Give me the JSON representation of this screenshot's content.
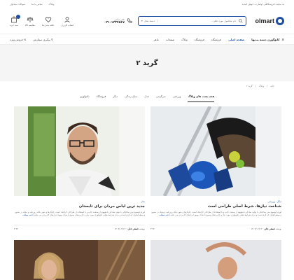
{
  "topbar": {
    "promo": "به سایت فروشگاهی اولمارت خوش آمدید",
    "links": [
      "وبلاگ",
      "تماس با ما",
      "سوالات متداول"
    ]
  },
  "header": {
    "logo": "olmart",
    "search_placeholder": "نام محصول مورد نظر...",
    "search_category": "دسته بندی",
    "phone_label": "تلفن تماس",
    "phone_number": "۰۲۱-۱۲۳۴۵۶۷",
    "icons": [
      {
        "name": "cart",
        "label": "سبد خرید",
        "badge": "۰"
      },
      {
        "name": "compare",
        "label": "مقایسه کالا"
      },
      {
        "name": "wishlist",
        "label": "علاقه مندی ها"
      },
      {
        "name": "account",
        "label": "حساب کاربری"
      }
    ]
  },
  "nav": {
    "categories_label": "کاتوگوری دسته بندیها",
    "items": [
      "صفحه اصلی",
      "فروشگاه",
      "فروشگاه",
      "وبلاگ",
      "صفحات",
      "ماهر"
    ],
    "left": [
      "پیگیری سفارش",
      "فروش ویژه"
    ]
  },
  "page": {
    "title": "گرید ۲",
    "breadcrumb": [
      "خانه",
      "وبلاگ",
      "گرید ۲"
    ]
  },
  "filters": [
    "همه پست های وبلاگ",
    "ورزشی",
    "سرگرمی",
    "مدل",
    "سبک زندگی",
    "دیگر",
    "فروشگاه",
    "تکنولوژی"
  ],
  "posts": [
    {
      "category": "دیگر ، ورزشی",
      "title": "شناخت نیازها، شرط اصلی طراحی است",
      "excerpt": "لورم ایپسوم متن ساختگی با تولید سادگی نامفهوم از صنعت چاپ و با استفاده از طراحان گرافیک است. چاپگرها و متون بلکه روزنامه و مجله در ستون و سطرآنچنان که لازم است و برای شرایط فعلی تکنولوژی مورد نیاز و کاربردهای متنوع با هدف بهبود ابزارهای کاربردی می باشد",
      "read_more": "ادامه مطلب",
      "author": "جعفر خان",
      "date": "۱۴۰۳/۰۲/۱۲",
      "comments": "۳"
    },
    {
      "category": "مدل",
      "title": "جدید ترین لباس مردان برای تابستان",
      "excerpt": "لورم ایپسوم متن ساختگی با تولید سادگی نامفهوم از صنعت چاپ و با استفاده از طراحان گرافیک است. چاپگرها و متون بلکه روزنامه و مجله در ستون و سطرآنچنان که لازم است و برای شرایط فعلی تکنولوژی مورد نیاز و کاربردهای متنوع با هدف بهبود ابزارهای کاربردی می باشد",
      "read_more": "ادامه مطلب",
      "author": "جعفر خان",
      "date": "۱۴۰۳/۰۲/۱۲",
      "comments": "۳"
    }
  ],
  "colors": {
    "accent": "#1e4fa3",
    "hero_bg": "#f5f5f5"
  }
}
